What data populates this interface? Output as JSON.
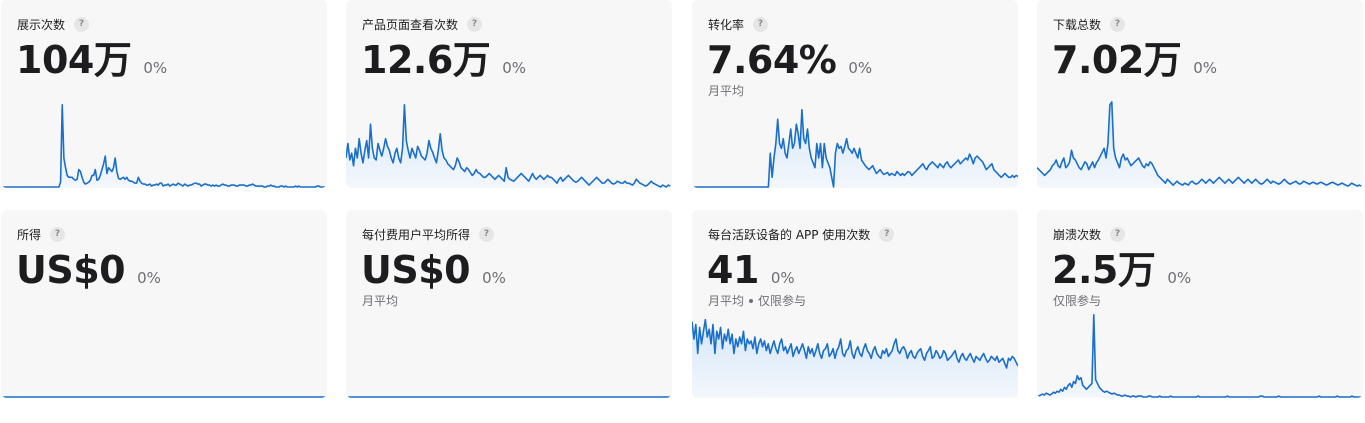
{
  "colors": {
    "line": "#1a6fcb",
    "fill_top": "#d5e6f8",
    "fill_bottom": "#f3f7fc",
    "card_bg": "#f7f7f7"
  },
  "help_icon_glyph": "?",
  "cards": [
    {
      "title": "展示次数",
      "value": "104万",
      "change": "0%",
      "note": "",
      "note_extra": "",
      "chart_data": {
        "type": "area",
        "values": [
          0,
          0,
          0,
          0,
          0,
          0,
          0,
          0,
          0,
          0,
          0,
          0,
          0,
          0,
          0,
          0,
          0,
          0,
          0,
          0,
          0,
          0,
          0,
          0,
          0,
          0,
          0,
          0,
          0,
          0,
          0,
          0,
          0,
          0,
          0,
          0,
          5,
          85,
          30,
          20,
          12,
          10,
          10,
          10,
          8,
          7,
          8,
          18,
          16,
          10,
          5,
          3,
          4,
          5,
          7,
          12,
          12,
          18,
          7,
          8,
          12,
          18,
          24,
          32,
          14,
          20,
          18,
          16,
          20,
          30,
          16,
          9,
          8,
          9,
          10,
          8,
          10,
          7,
          6,
          6,
          5,
          4,
          4,
          10,
          6,
          4,
          3,
          3,
          2,
          2,
          3,
          1,
          2,
          2,
          3,
          2,
          4,
          4,
          1,
          2,
          2,
          3,
          1,
          2,
          3,
          2,
          2,
          4,
          3,
          2,
          1,
          3,
          2,
          1,
          2,
          2,
          3,
          4,
          4,
          3,
          3,
          1,
          2,
          3,
          3,
          2,
          2,
          1,
          2,
          1,
          2,
          1,
          1,
          2,
          3,
          2,
          2,
          1,
          1,
          2,
          2,
          2,
          1,
          1,
          2,
          2,
          2,
          2,
          1,
          1,
          2,
          2,
          3,
          2,
          1,
          1,
          1,
          1,
          1,
          0,
          0,
          1,
          1,
          2,
          1,
          1,
          0,
          0,
          0,
          1,
          1,
          0,
          1,
          0,
          0,
          0,
          0,
          0,
          1,
          0,
          1,
          0,
          0,
          0,
          0,
          0,
          0,
          0,
          0,
          0,
          0,
          1,
          1,
          0,
          0,
          0,
          0,
          0
        ],
        "ylim": [
          0,
          90
        ]
      }
    },
    {
      "title": "产品页面查看次数",
      "value": "12.6万",
      "change": "0%",
      "note": "",
      "note_extra": "",
      "chart_data": {
        "type": "area",
        "values": [
          30,
          45,
          28,
          35,
          22,
          40,
          30,
          50,
          35,
          25,
          38,
          48,
          30,
          65,
          40,
          30,
          28,
          45,
          38,
          32,
          40,
          50,
          42,
          38,
          30,
          25,
          35,
          40,
          30,
          25,
          40,
          85,
          48,
          38,
          30,
          40,
          35,
          30,
          42,
          38,
          32,
          30,
          28,
          35,
          48,
          40,
          36,
          30,
          25,
          38,
          55,
          38,
          30,
          28,
          24,
          22,
          20,
          18,
          22,
          30,
          26,
          20,
          18,
          16,
          20,
          18,
          15,
          12,
          14,
          18,
          15,
          14,
          12,
          10,
          10,
          12,
          14,
          12,
          10,
          8,
          10,
          12,
          10,
          8,
          6,
          20,
          10,
          8,
          7,
          6,
          8,
          10,
          12,
          14,
          12,
          10,
          8,
          6,
          10,
          14,
          10,
          8,
          10,
          12,
          10,
          8,
          10,
          12,
          10,
          10,
          8,
          6,
          4,
          8,
          10,
          6,
          8,
          10,
          12,
          10,
          8,
          6,
          5,
          6,
          8,
          10,
          8,
          6,
          4,
          2,
          4,
          6,
          8,
          10,
          8,
          6,
          4,
          4,
          6,
          8,
          6,
          4,
          3,
          4,
          6,
          5,
          4,
          4,
          6,
          4,
          4,
          3,
          2,
          4,
          8,
          6,
          4,
          3,
          2,
          1,
          2,
          4,
          6,
          4,
          3,
          2,
          1,
          0,
          2,
          1,
          0,
          2,
          1,
          0
        ],
        "ylim": [
          0,
          90
        ]
      }
    },
    {
      "title": "转化率",
      "value": "7.64%",
      "change": "0%",
      "note": "月平均",
      "note_extra": "",
      "chart_data": {
        "type": "area",
        "values": [
          0,
          0,
          0,
          0,
          0,
          0,
          0,
          0,
          0,
          0,
          0,
          0,
          0,
          0,
          0,
          0,
          0,
          0,
          0,
          0,
          0,
          0,
          0,
          0,
          0,
          0,
          0,
          0,
          0,
          0,
          0,
          0,
          0,
          0,
          0,
          0,
          0,
          0,
          0,
          0,
          0,
          0,
          35,
          10,
          30,
          45,
          70,
          45,
          40,
          50,
          35,
          30,
          45,
          60,
          40,
          45,
          65,
          55,
          40,
          80,
          50,
          45,
          60,
          40,
          30,
          25,
          20,
          45,
          30,
          45,
          20,
          45,
          30,
          25,
          20,
          10,
          0,
          35,
          45,
          40,
          42,
          35,
          42,
          50,
          40,
          38,
          35,
          40,
          35,
          30,
          40,
          28,
          25,
          22,
          20,
          18,
          20,
          22,
          18,
          14,
          16,
          18,
          15,
          13,
          14,
          15,
          12,
          14,
          13,
          12,
          16,
          14,
          12,
          14,
          12,
          14,
          16,
          15,
          12,
          14,
          16,
          18,
          20,
          22,
          24,
          20,
          18,
          22,
          24,
          26,
          24,
          22,
          20,
          24,
          22,
          20,
          24,
          26,
          22,
          20,
          22,
          24,
          26,
          28,
          24,
          26,
          28,
          30,
          28,
          34,
          30,
          24,
          30,
          32,
          30,
          28,
          26,
          22,
          18,
          20,
          22,
          24,
          18,
          16,
          14,
          12,
          10,
          12,
          14,
          12,
          10,
          10,
          12,
          10,
          12,
          11
        ],
        "ylim": [
          0,
          90
        ]
      }
    },
    {
      "title": "下载总数",
      "value": "7.02万",
      "change": "0%",
      "note": "",
      "note_extra": "",
      "chart_data": {
        "type": "area",
        "values": [
          20,
          18,
          16,
          14,
          12,
          14,
          16,
          18,
          22,
          24,
          28,
          22,
          20,
          26,
          30,
          20,
          22,
          26,
          38,
          30,
          28,
          24,
          20,
          18,
          22,
          26,
          24,
          18,
          22,
          26,
          20,
          25,
          28,
          32,
          36,
          40,
          30,
          45,
          85,
          88,
          40,
          30,
          25,
          20,
          30,
          34,
          28,
          30,
          26,
          22,
          24,
          26,
          28,
          30,
          26,
          22,
          20,
          24,
          22,
          26,
          24,
          20,
          16,
          12,
          10,
          8,
          6,
          4,
          8,
          6,
          4,
          2,
          4,
          6,
          4,
          3,
          2,
          4,
          3,
          2,
          5,
          6,
          4,
          3,
          4,
          6,
          8,
          6,
          4,
          6,
          8,
          6,
          4,
          6,
          8,
          10,
          8,
          6,
          4,
          6,
          8,
          6,
          4,
          6,
          8,
          10,
          8,
          6,
          4,
          6,
          8,
          6,
          4,
          6,
          8,
          6,
          4,
          3,
          4,
          6,
          8,
          6,
          4,
          6,
          5,
          4,
          3,
          4,
          6,
          8,
          6,
          4,
          3,
          4,
          5,
          6,
          4,
          3,
          4,
          6,
          5,
          4,
          3,
          4,
          5,
          4,
          3,
          4,
          5,
          4,
          3,
          2,
          3,
          4,
          5,
          4,
          3,
          2,
          3,
          4,
          3,
          2,
          1,
          2,
          4,
          3,
          2,
          1,
          2,
          1,
          0
        ],
        "ylim": [
          0,
          90
        ]
      }
    },
    {
      "title": "所得",
      "value": "US$0",
      "change": "0%",
      "note": "",
      "note_extra": "",
      "chart_data": {
        "type": "area",
        "values": [
          0,
          0,
          0,
          0,
          0,
          0,
          0,
          0,
          0,
          0,
          0,
          0,
          0,
          0,
          0,
          0,
          0,
          0,
          0,
          0,
          0,
          0,
          0,
          0,
          0,
          0,
          0,
          0,
          0,
          0,
          0,
          0,
          0,
          0,
          0,
          0,
          0,
          0,
          0,
          0,
          0,
          0,
          0,
          0,
          0,
          0,
          0,
          0,
          0,
          0,
          0,
          0,
          0,
          0,
          0,
          0,
          0,
          0,
          0,
          0,
          0,
          0,
          0,
          0,
          0,
          0,
          0,
          0,
          0,
          0,
          0,
          0,
          0,
          0,
          0,
          0,
          0,
          0,
          0,
          0
        ],
        "ylim": [
          0,
          90
        ]
      }
    },
    {
      "title": "每付费用户平均所得",
      "value": "US$0",
      "change": "0%",
      "note": "月平均",
      "note_extra": "",
      "chart_data": {
        "type": "area",
        "values": [
          0,
          0,
          0,
          0,
          0,
          0,
          0,
          0,
          0,
          0,
          0,
          0,
          0,
          0,
          0,
          0,
          0,
          0,
          0,
          0,
          0,
          0,
          0,
          0,
          0,
          0,
          0,
          0,
          0,
          0,
          0,
          0,
          0,
          0,
          0,
          0,
          0,
          0,
          0,
          0,
          0,
          0,
          0,
          0,
          0,
          0,
          0,
          0,
          0,
          0,
          0,
          0,
          0,
          0,
          0,
          0,
          0,
          0,
          0,
          0,
          0,
          0,
          0,
          0,
          0,
          0,
          0,
          0,
          0,
          0,
          0,
          0,
          0,
          0,
          0,
          0,
          0,
          0,
          0,
          0
        ],
        "ylim": [
          0,
          90
        ]
      }
    },
    {
      "title": "每台活跃设备的 APP 使用次数",
      "value": "41",
      "change": "0%",
      "note": "月平均",
      "note_extra": "仅限参与",
      "chart_data": {
        "type": "area",
        "values": [
          78,
          60,
          75,
          45,
          72,
          55,
          68,
          80,
          62,
          70,
          55,
          75,
          45,
          68,
          60,
          72,
          50,
          65,
          58,
          70,
          55,
          65,
          45,
          60,
          52,
          62,
          55,
          68,
          48,
          60,
          55,
          58,
          50,
          62,
          45,
          55,
          60,
          52,
          58,
          48,
          55,
          45,
          52,
          58,
          50,
          45,
          55,
          60,
          48,
          52,
          45,
          50,
          55,
          42,
          48,
          52,
          45,
          50,
          55,
          48,
          40,
          52,
          45,
          50,
          42,
          48,
          55,
          45,
          40,
          48,
          50,
          55,
          42,
          45,
          50,
          40,
          48,
          52,
          60,
          45,
          42,
          48,
          50,
          58,
          45,
          40,
          48,
          52,
          45,
          42,
          50,
          55,
          48,
          45,
          40,
          48,
          52,
          45,
          42,
          40,
          48,
          45,
          50,
          42,
          45,
          48,
          55,
          60,
          48,
          45,
          50,
          52,
          48,
          40,
          45,
          48,
          42,
          40,
          45,
          48,
          50,
          42,
          38,
          45,
          48,
          52,
          40,
          42,
          48,
          45,
          40,
          42,
          48,
          45,
          38,
          40,
          42,
          45,
          48,
          40,
          36,
          42,
          45,
          40,
          38,
          42,
          45,
          40,
          36,
          42,
          40,
          38,
          42,
          45,
          40,
          36,
          38,
          42,
          40,
          38,
          42,
          36,
          38,
          40,
          35,
          30,
          40,
          38,
          42,
          40,
          36,
          32
        ],
        "ylim": [
          0,
          90
        ]
      }
    },
    {
      "title": "崩溃次数",
      "value": "2.5万",
      "change": "0%",
      "note": "仅限参与",
      "note_extra": "",
      "chart_data": {
        "type": "area",
        "values": [
          2,
          1,
          2,
          3,
          2,
          4,
          3,
          2,
          3,
          5,
          4,
          6,
          5,
          8,
          6,
          10,
          8,
          12,
          14,
          10,
          16,
          14,
          22,
          18,
          20,
          12,
          10,
          8,
          10,
          12,
          14,
          85,
          18,
          14,
          10,
          8,
          6,
          5,
          6,
          5,
          4,
          3,
          4,
          3,
          2,
          2,
          1,
          1,
          2,
          1,
          1,
          0,
          1,
          1,
          0,
          1,
          1,
          1,
          0,
          0,
          0,
          1,
          1,
          0,
          0,
          0,
          0,
          1,
          0,
          0,
          0,
          0,
          0,
          1,
          0,
          0,
          0,
          0,
          0,
          0,
          0,
          0,
          0,
          0,
          0,
          0,
          0,
          0,
          1,
          0,
          0,
          0,
          0,
          0,
          0,
          0,
          0,
          0,
          0,
          0,
          0,
          0,
          0,
          0,
          1,
          0,
          0,
          0,
          0,
          0,
          0,
          0,
          0,
          0,
          0,
          0,
          0,
          0,
          0,
          0,
          0,
          0,
          1,
          1,
          0,
          0,
          0,
          0,
          0,
          0,
          0,
          0,
          1,
          0,
          0,
          0,
          0,
          0,
          0,
          0,
          0,
          0,
          0,
          0,
          0,
          0,
          0,
          0,
          0,
          0,
          0,
          0,
          0,
          0,
          1,
          0,
          0,
          0,
          0,
          0,
          0,
          0,
          0,
          0,
          1,
          0,
          0,
          0,
          0,
          0,
          0,
          0,
          1,
          0,
          0,
          0,
          0,
          0,
          0
        ],
        "ylim": [
          0,
          90
        ]
      }
    }
  ]
}
